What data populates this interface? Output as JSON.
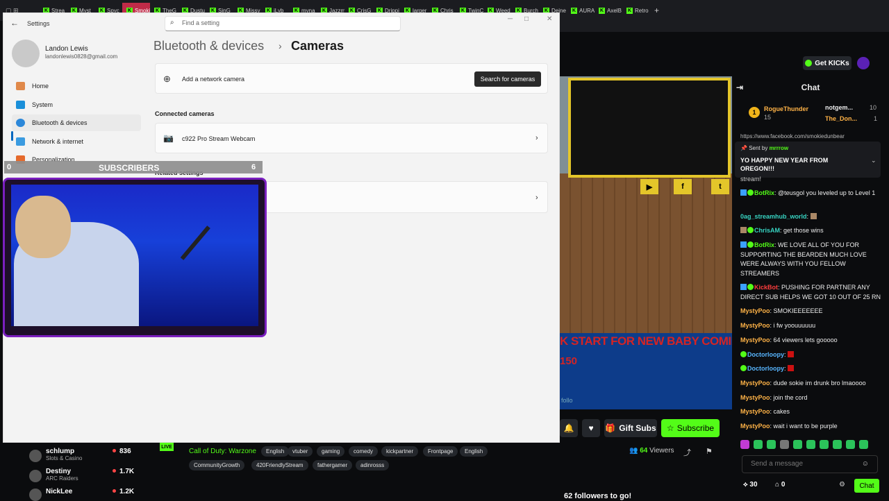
{
  "browser": {
    "tabs": [
      {
        "label": "Strea"
      },
      {
        "label": "Myst"
      },
      {
        "label": "Spyc"
      },
      {
        "label": "Smoki",
        "active": true
      },
      {
        "label": "TheG"
      },
      {
        "label": "Dustu"
      },
      {
        "label": "SinG"
      },
      {
        "label": "Missy"
      },
      {
        "label": "iLyb"
      },
      {
        "label": "myna"
      },
      {
        "label": "Jazzm"
      },
      {
        "label": "CrisG"
      },
      {
        "label": "Drippi"
      },
      {
        "label": "larger"
      },
      {
        "label": "Chris"
      },
      {
        "label": "TwinC"
      },
      {
        "label": "Weed"
      },
      {
        "label": "Burch"
      },
      {
        "label": "Deine"
      },
      {
        "label": "AURA"
      },
      {
        "label": "AxelB"
      },
      {
        "label": "Retro"
      }
    ],
    "new_tab": "+"
  },
  "kick": {
    "get_kicks": "Get KICKs",
    "stream": {
      "banner_text": "K START FOR NEW BABY COMING IN APRIL",
      "banner_num": "150",
      "banner_small": "follo"
    },
    "actions": {
      "gift_subs": "Gift Subs",
      "subscribe": "Subscribe"
    },
    "chat": {
      "title": "Chat",
      "leaderboard": [
        {
          "rank": "1",
          "name": "RogueThunder",
          "count": "15"
        },
        {
          "name": "notgem...",
          "count": "10"
        },
        {
          "name": "The_Don...",
          "count": "1"
        }
      ],
      "scrolled_line": "https://www.facebook.com/smokiedunbear",
      "pinned": {
        "sent_by_label": "Sent by",
        "sent_by": "mrrrow",
        "text": "YO HAPPY NEW YEAR FROM OREGON!!!"
      },
      "partial_line": "stream!",
      "messages": [
        {
          "user": "BotRix",
          "text": "@teusgol you leveled up to Level 1"
        },
        {
          "user": "0ag_streamhub_world",
          "text": ""
        },
        {
          "user": "ChrisAM",
          "text": "get those wins"
        },
        {
          "user": "BotRix",
          "text": "WE LOVE ALL OF YOU FOR SUPPORTING THE BEARDEN MUCH LOVE WERE ALWAYS WITH YOU FELLOW STREAMERS"
        },
        {
          "user": "KickBot",
          "text": "PUSHING FOR PARTNER ANY DIRECT SUB HELPS WE GOT 10 OUT OF 25 RN"
        },
        {
          "user": "MystyPoo",
          "text": "SMOKIEEEEEEE"
        },
        {
          "user": "MystyPoo",
          "text": "i fw yoouuuuuu"
        },
        {
          "user": "MystyPoo",
          "text": "64 viewers lets gooooo"
        },
        {
          "user": "Doctorloopy",
          "text": ""
        },
        {
          "user": "Doctorloopy",
          "text": ""
        },
        {
          "user": "MystyPoo",
          "text": "dude sokie im drunk bro lmaoooo"
        },
        {
          "user": "MystyPoo",
          "text": "join the cord"
        },
        {
          "user": "MystyPoo",
          "text": "cakes"
        },
        {
          "user": "MystyPoo",
          "text": "wait i want to be purple"
        }
      ],
      "send_placeholder": "Send a message",
      "points": "30",
      "points2": "0",
      "chat_button": "Chat"
    },
    "sidebar": [
      {
        "name": "schlump",
        "category": "Slots & Casino",
        "viewers": "836"
      },
      {
        "name": "Destiny",
        "category": "ARC Raiders",
        "viewers": "1.7K"
      },
      {
        "name": "NickLee",
        "category": "",
        "viewers": "1.2K"
      }
    ],
    "live_badge": "LIVE",
    "game": "Call of Duty: Warzone",
    "tags": [
      "English",
      "vtuber",
      "gaming",
      "comedy",
      "kickpartner",
      "Frontpage",
      "English",
      "CommunityGrowth",
      "420FriendlyStream",
      "fathergamer",
      "adinrosss"
    ],
    "viewers_count": "64",
    "viewers_label": "Viewers",
    "followers_text": "62 followers to go!"
  },
  "settings": {
    "window_title": "Settings",
    "search_placeholder": "Find a setting",
    "user": {
      "name": "Landon Lewis",
      "email": "landonlewis0828@gmail.com"
    },
    "nav": [
      {
        "label": "Home"
      },
      {
        "label": "System"
      },
      {
        "label": "Bluetooth & devices"
      },
      {
        "label": "Network & internet"
      },
      {
        "label": "Personalization"
      }
    ],
    "breadcrumb_parent": "Bluetooth & devices",
    "breadcrumb_current": "Cameras",
    "add_camera_label": "Add a network camera",
    "search_cameras_button": "Search for cameras",
    "connected_header": "Connected cameras",
    "camera_name": "c922 Pro Stream Webcam",
    "related_header": "Related settings"
  },
  "overlay": {
    "subs_left": "0",
    "subs_title": "SUBSCRIBERS",
    "subs_right": "6"
  },
  "colors": {
    "kick_green": "#53fc18",
    "overlay_purple": "#7a1fbf",
    "active_tab": "#c02b48"
  }
}
